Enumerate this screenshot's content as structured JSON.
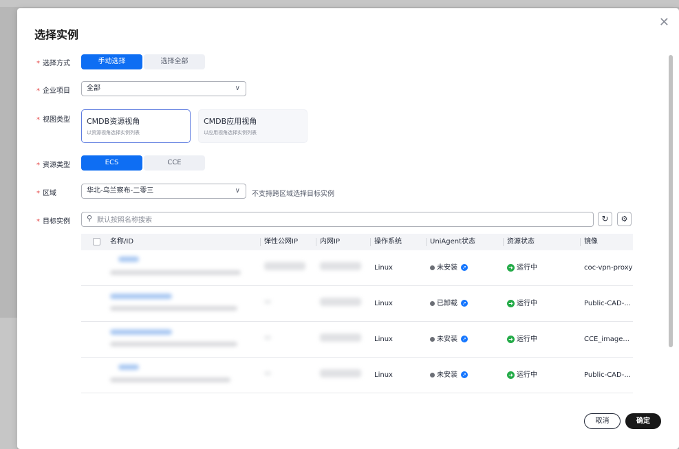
{
  "dialog": {
    "title": "选择实例",
    "close_icon": "close-icon"
  },
  "form": {
    "select_mode": {
      "label": "选择方式",
      "options": [
        "手动选择",
        "选择全部"
      ],
      "selected": 0
    },
    "enterprise_project": {
      "label": "企业项目",
      "value": "全部"
    },
    "view_type": {
      "label": "视图类型",
      "cards": [
        {
          "title": "CMDB资源视角",
          "desc": "以资源视角选择实例列表"
        },
        {
          "title": "CMDB应用视角",
          "desc": "以应用视角选择实例列表"
        }
      ],
      "selected": 0
    },
    "resource_type": {
      "label": "资源类型",
      "options": [
        "ECS",
        "CCE"
      ],
      "selected": 0
    },
    "region": {
      "label": "区域",
      "value": "华北-乌兰察布-二零三",
      "hint": "不支持跨区域选择目标实例"
    },
    "target": {
      "label": "目标实例",
      "search_placeholder": "默认按照名称搜索"
    }
  },
  "table": {
    "columns": [
      "名称/ID",
      "弹性公网IP",
      "内网IP",
      "操作系统",
      "UniAgent状态",
      "资源状态",
      "镜像"
    ],
    "rows": [
      {
        "os": "Linux",
        "agent": "未安装",
        "status": "运行中",
        "image": "coc-vpn-proxy"
      },
      {
        "os": "Linux",
        "agent": "已卸载",
        "status": "运行中",
        "image": "Public-CAD-..."
      },
      {
        "os": "Linux",
        "agent": "未安装",
        "status": "运行中",
        "image": "CCE_image..."
      },
      {
        "os": "Linux",
        "agent": "未安装",
        "status": "运行中",
        "image": "Public-CAD-..."
      }
    ]
  },
  "footer": {
    "cancel": "取消",
    "confirm": "确定"
  },
  "colors": {
    "primary": "#0e6ef3",
    "required": "#e54545",
    "running": "#24ab48",
    "agent": "#1677ff"
  }
}
